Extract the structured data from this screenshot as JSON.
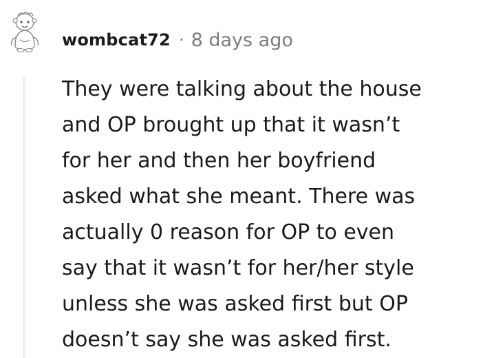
{
  "comment": {
    "username": "wombcat72",
    "separator": "·",
    "timestamp": "8 days ago",
    "avatar_icon": "snoo-avatar-icon",
    "body_lines": [
      "They were talking about the house",
      "and OP brought up that it wasn’t",
      "for her and then her boyfriend",
      "asked what she meant. There was",
      "actually 0 reason for OP to even",
      "say that it wasn’t for her/her style",
      "unless she was asked first but OP",
      "doesn’t say she was asked first."
    ]
  },
  "colors": {
    "text": "#1a1a1b",
    "meta": "#7c7c7c",
    "thread_line": "#edeff1",
    "background": "#ffffff"
  }
}
